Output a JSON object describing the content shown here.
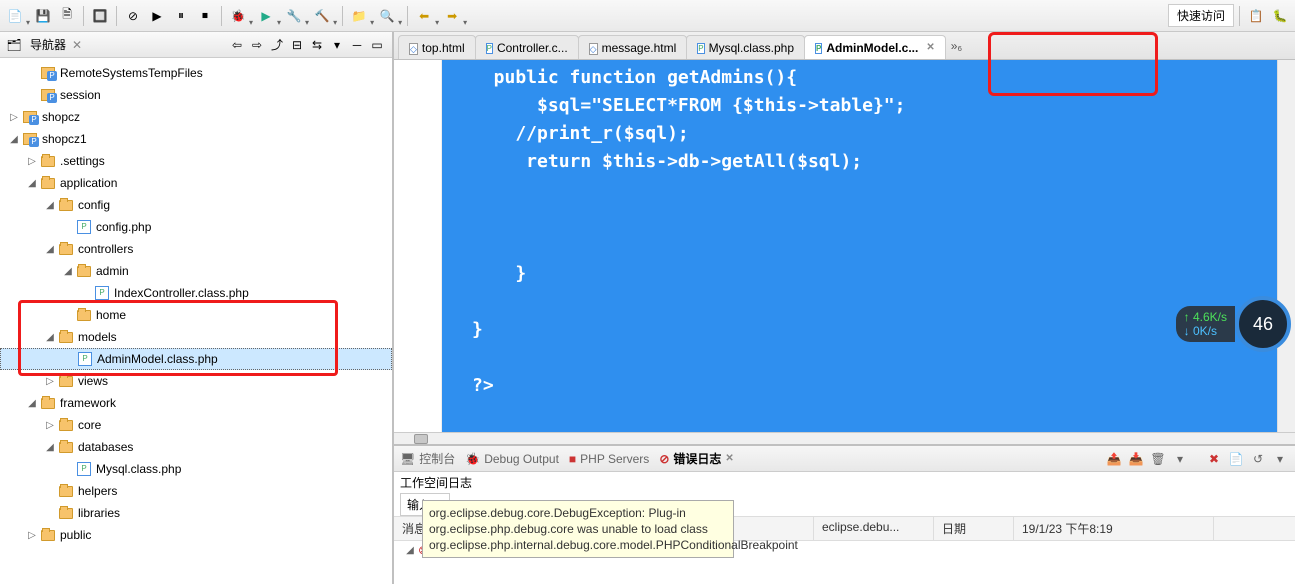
{
  "quick_access": "快速访问",
  "navigator": {
    "title": "导航器",
    "items": [
      {
        "indent": 1,
        "twisty": "",
        "icon": "proj",
        "label": "RemoteSystemsTempFiles"
      },
      {
        "indent": 1,
        "twisty": "",
        "icon": "proj",
        "label": "session"
      },
      {
        "indent": 0,
        "twisty": "▷",
        "icon": "proj",
        "label": "shopcz"
      },
      {
        "indent": 0,
        "twisty": "◢",
        "icon": "proj",
        "label": "shopcz1"
      },
      {
        "indent": 1,
        "twisty": "▷",
        "icon": "folder",
        "label": ".settings"
      },
      {
        "indent": 1,
        "twisty": "◢",
        "icon": "folder",
        "label": "application"
      },
      {
        "indent": 2,
        "twisty": "◢",
        "icon": "folder",
        "label": "config"
      },
      {
        "indent": 3,
        "twisty": "",
        "icon": "php",
        "label": "config.php"
      },
      {
        "indent": 2,
        "twisty": "◢",
        "icon": "folder",
        "label": "controllers"
      },
      {
        "indent": 3,
        "twisty": "◢",
        "icon": "folder",
        "label": "admin"
      },
      {
        "indent": 4,
        "twisty": "",
        "icon": "php",
        "label": "IndexController.class.php"
      },
      {
        "indent": 3,
        "twisty": "",
        "icon": "folder",
        "label": "home"
      },
      {
        "indent": 2,
        "twisty": "◢",
        "icon": "folder",
        "label": "models"
      },
      {
        "indent": 3,
        "twisty": "",
        "icon": "php",
        "label": "AdminModel.class.php",
        "selected": true
      },
      {
        "indent": 2,
        "twisty": "▷",
        "icon": "folder",
        "label": "views"
      },
      {
        "indent": 1,
        "twisty": "◢",
        "icon": "folder",
        "label": "framework"
      },
      {
        "indent": 2,
        "twisty": "▷",
        "icon": "folder",
        "label": "core"
      },
      {
        "indent": 2,
        "twisty": "◢",
        "icon": "folder",
        "label": "databases"
      },
      {
        "indent": 3,
        "twisty": "",
        "icon": "php",
        "label": "Mysql.class.php"
      },
      {
        "indent": 2,
        "twisty": "",
        "icon": "folder",
        "label": "helpers"
      },
      {
        "indent": 2,
        "twisty": "",
        "icon": "folder",
        "label": "libraries"
      },
      {
        "indent": 1,
        "twisty": "▷",
        "icon": "folder",
        "label": "public"
      }
    ]
  },
  "tabs": [
    {
      "icon": "html",
      "label": "top.html"
    },
    {
      "icon": "php",
      "label": "Controller.c..."
    },
    {
      "icon": "html",
      "label": "message.html"
    },
    {
      "icon": "php",
      "label": "Mysql.class.php"
    },
    {
      "icon": "php",
      "label": "AdminModel.c...",
      "active": true
    }
  ],
  "tab_overflow": "»₆",
  "code_lines": [
    "  public function getAdmins(){",
    "      $sql=\"SELECT*FROM {$this->table}\";",
    "    //print_r($sql);",
    "     return $this->db->getAll($sql);",
    "",
    "",
    "",
    "    }",
    "",
    "}",
    "",
    "?>"
  ],
  "speed": {
    "up": "4.6K/s",
    "down": "0K/s",
    "score": "46"
  },
  "bottom": {
    "tabs": [
      "控制台",
      "Debug Output",
      "PHP Servers",
      "错误日志"
    ],
    "workspace_label": "工作空间日志",
    "input_label": "输入",
    "headers": {
      "msg": "消息",
      "plugin": "日期",
      "date": "19/1/23 下午8:19",
      "plg_col": "日期"
    },
    "col_msg": "消息",
    "col_date": "日期",
    "row_plugin": "eclipse.debu...",
    "row_date": "19/1/23 下午8:19",
    "tooltip": "org.eclipse.debug.core.DebugException: Plug-in org.eclipse.php.debug.core was unable to load class org.eclipse.php.internal.debug.core.model.PHPConditionalBreakpoint"
  }
}
